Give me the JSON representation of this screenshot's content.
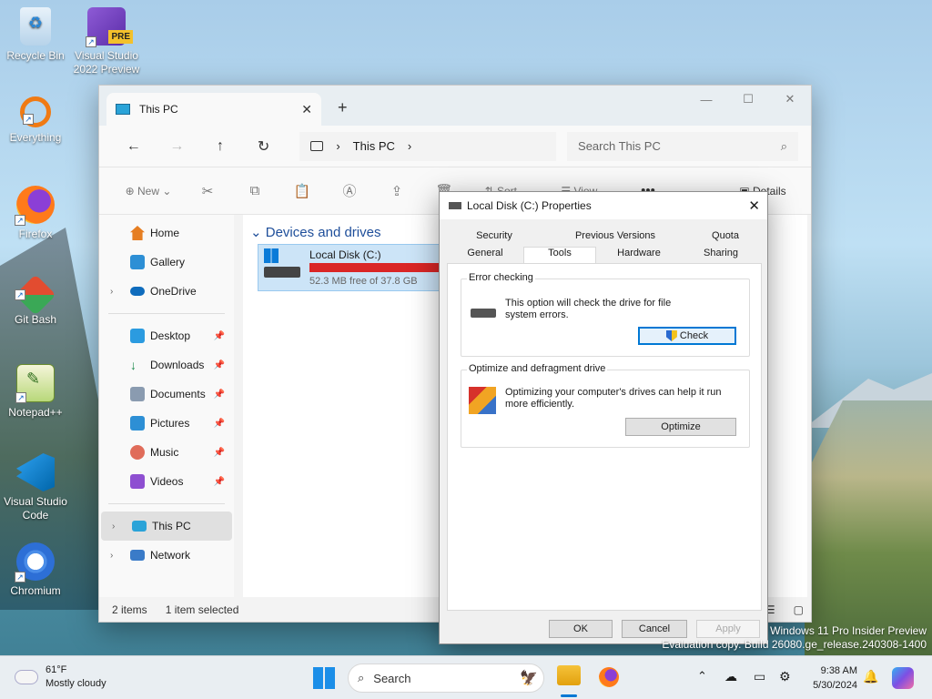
{
  "desktop": {
    "icons": [
      {
        "label": "Recycle Bin",
        "icon": "recycle-bin-icon"
      },
      {
        "label": "Visual Studio 2022 Preview",
        "badge": "PRE",
        "icon": "visual-studio-icon"
      },
      {
        "label": "Everything",
        "icon": "everything-search-icon"
      },
      {
        "label": "Firefox",
        "icon": "firefox-icon"
      },
      {
        "label": "Git Bash",
        "icon": "git-bash-icon"
      },
      {
        "label": "Notepad++",
        "icon": "notepadpp-icon"
      },
      {
        "label": "Visual Studio Code",
        "icon": "vscode-icon"
      },
      {
        "label": "Chromium",
        "icon": "chromium-icon"
      }
    ]
  },
  "explorer": {
    "tab_title": "This PC",
    "address": "This PC",
    "search_placeholder": "Search This PC",
    "commands": {
      "new": "New",
      "sort": "Sort",
      "view": "View",
      "more": "•••",
      "details": "Details"
    },
    "nav": {
      "home": "Home",
      "gallery": "Gallery",
      "onedrive": "OneDrive",
      "desktop": "Desktop",
      "downloads": "Downloads",
      "documents": "Documents",
      "pictures": "Pictures",
      "music": "Music",
      "videos": "Videos",
      "thispc": "This PC",
      "network": "Network"
    },
    "section_header": "Devices and drives",
    "drive": {
      "name": "Local Disk (C:)",
      "free": "52.3 MB free of 37.8 GB",
      "used_fraction": 0.999
    },
    "status": {
      "items": "2 items",
      "selected": "1 item selected"
    }
  },
  "dialog": {
    "title": "Local Disk (C:) Properties",
    "tabs_row1": [
      "Security",
      "Previous Versions",
      "Quota"
    ],
    "tabs_row2": [
      "General",
      "Tools",
      "Hardware",
      "Sharing"
    ],
    "error_group": {
      "title": "Error checking",
      "text": "This option will check the drive for file system errors.",
      "button": "Check"
    },
    "optimize_group": {
      "title": "Optimize and defragment drive",
      "text": "Optimizing your computer's drives can help it run more efficiently.",
      "button": "Optimize"
    },
    "buttons": {
      "ok": "OK",
      "cancel": "Cancel",
      "apply": "Apply"
    }
  },
  "watermark": {
    "line1": "Windows 11 Pro Insider Preview",
    "line2": "Evaluation copy. Build 26080.ge_release.240308-1400"
  },
  "taskbar": {
    "temp": "61°F",
    "weather": "Mostly cloudy",
    "search": "Search",
    "time": "9:38 AM",
    "date": "5/30/2024"
  },
  "colors": {
    "accent": "#0078d4",
    "drive_bar": "#da2626",
    "section": "#1e4e9a"
  }
}
